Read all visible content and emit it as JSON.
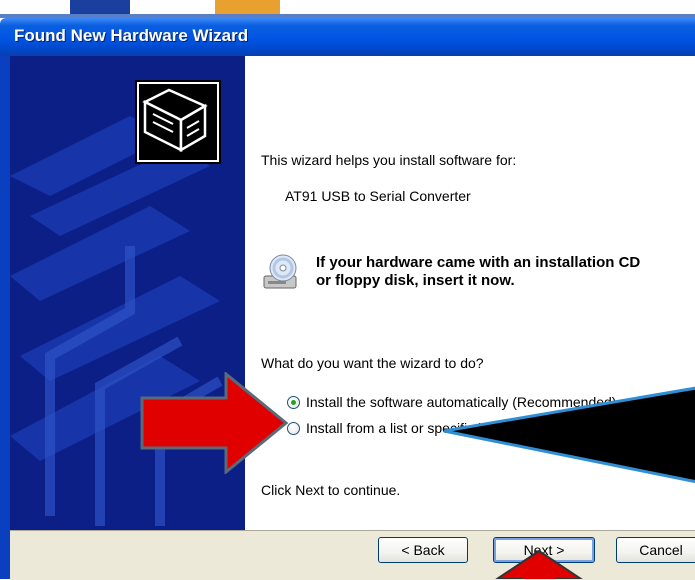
{
  "window": {
    "title": "Found New Hardware Wizard"
  },
  "content": {
    "intro": "This wizard helps you install software for:",
    "device": "AT91 USB to Serial Converter",
    "cd_notice_line1": "If your hardware came with an installation CD",
    "cd_notice_line2": "or floppy disk, insert it now.",
    "question": "What do you want the wizard to do?",
    "options": [
      {
        "label": "Install the software automatically (Recommended)",
        "selected": true
      },
      {
        "label": "Install from a list or specific location (Advanced)",
        "selected": false
      }
    ],
    "continue_hint": "Click Next to continue."
  },
  "buttons": {
    "back": "< Back",
    "next": "Next >",
    "cancel": "Cancel"
  },
  "icons": {
    "hardware": "hardware-wizard-icon",
    "cd": "cd-drive-icon"
  },
  "colors": {
    "titlebar": "#0054e3",
    "sidepanel": "#0b1f87",
    "footer": "#ece9d8",
    "red_arrow": "#e00000",
    "callout": "#000000",
    "callout_outline": "#2f8fd6"
  }
}
